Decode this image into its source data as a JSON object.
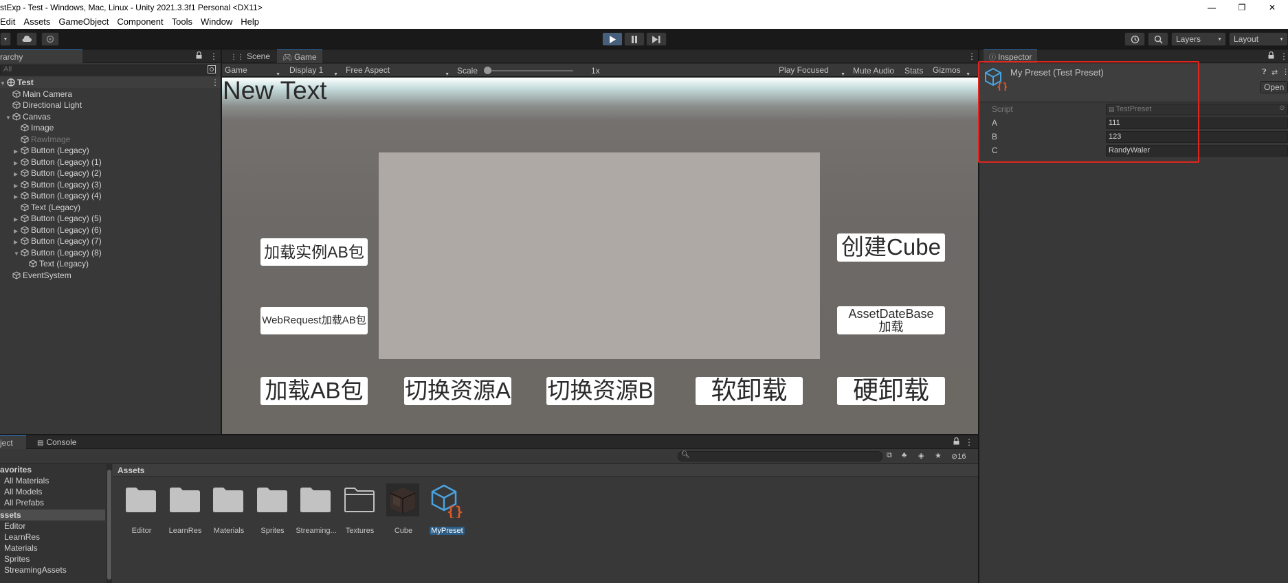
{
  "window": {
    "title": "stExp - Test - Windows, Mac, Linux - Unity 2021.3.3f1 Personal <DX11>",
    "minimize": "—",
    "maximize": "❐",
    "close": "✕"
  },
  "menu": [
    "Edit",
    "Assets",
    "GameObject",
    "Component",
    "Tools",
    "Window",
    "Help"
  ],
  "toolbar": {
    "play_icon": "play-icon",
    "pause_icon": "pause-icon",
    "step_icon": "step-icon",
    "layers_label": "Layers",
    "layout_label": "Layout"
  },
  "hierarchy": {
    "tab_label": "rarchy",
    "search_placeholder": "All",
    "items": [
      {
        "label": "Test",
        "level": 0,
        "expanded": true,
        "scene": true
      },
      {
        "label": "Main Camera",
        "level": 1
      },
      {
        "label": "Directional Light",
        "level": 1
      },
      {
        "label": "Canvas",
        "level": 1,
        "expanded": true
      },
      {
        "label": "Image",
        "level": 2
      },
      {
        "label": "RawImage",
        "level": 2,
        "dim": true
      },
      {
        "label": "Button (Legacy)",
        "level": 2,
        "collapsed": true
      },
      {
        "label": "Button (Legacy) (1)",
        "level": 2,
        "collapsed": true
      },
      {
        "label": "Button (Legacy) (2)",
        "level": 2,
        "collapsed": true
      },
      {
        "label": "Button (Legacy) (3)",
        "level": 2,
        "collapsed": true
      },
      {
        "label": "Button (Legacy) (4)",
        "level": 2,
        "collapsed": true
      },
      {
        "label": "Text (Legacy)",
        "level": 2
      },
      {
        "label": "Button (Legacy) (5)",
        "level": 2,
        "collapsed": true
      },
      {
        "label": "Button (Legacy) (6)",
        "level": 2,
        "collapsed": true
      },
      {
        "label": "Button (Legacy) (7)",
        "level": 2,
        "collapsed": true
      },
      {
        "label": "Button (Legacy) (8)",
        "level": 2,
        "expanded": true
      },
      {
        "label": "Text (Legacy)",
        "level": 3
      },
      {
        "label": "EventSystem",
        "level": 1
      }
    ]
  },
  "scene_tabs": {
    "scene": "Scene",
    "game": "Game"
  },
  "game_toolbar": {
    "view": "Game",
    "display": "Display 1",
    "aspect": "Free Aspect",
    "scale_label": "Scale",
    "scale_value": "1x",
    "play_focused": "Play Focused",
    "mute_audio": "Mute Audio",
    "stats": "Stats",
    "gizmos": "Gizmos"
  },
  "game_view": {
    "new_text": "New Text",
    "buttons": {
      "load_instance_ab": "加载实例AB包",
      "webrequest_ab": "WebRequest加载AB包",
      "create_cube": "创建Cube",
      "assetdatabase_load": [
        "AssetDateBase",
        "加载"
      ],
      "load_ab": "加载AB包",
      "switch_a": "切换资源A",
      "switch_b": "切换资源B",
      "soft_unload": "软卸载",
      "hard_unload": "硬卸载"
    }
  },
  "inspector": {
    "tab_label": "Inspector",
    "asset_title": "My Preset (Test Preset)",
    "open_button": "Open",
    "highlight_color": "#e0261f",
    "properties": [
      {
        "label": "Script",
        "value": "TestPreset",
        "readonly": true
      },
      {
        "label": "A",
        "value": "111"
      },
      {
        "label": "B",
        "value": "123"
      },
      {
        "label": "C",
        "value": "RandyWaler"
      }
    ]
  },
  "project": {
    "tab_label": "ject",
    "console_label": "Console",
    "favorites": {
      "header": "avorites",
      "items": [
        "All Materials",
        "All Models",
        "All Prefabs"
      ]
    },
    "assets_tree": {
      "header": "ssets",
      "items": [
        "Editor",
        "LearnRes",
        "Materials",
        "Sprites",
        "StreamingAssets"
      ]
    },
    "breadcrumb": "Assets",
    "hidden_count": "16",
    "assets": [
      {
        "name": "Editor",
        "kind": "folder"
      },
      {
        "name": "LearnRes",
        "kind": "folder"
      },
      {
        "name": "Materials",
        "kind": "folder"
      },
      {
        "name": "Sprites",
        "kind": "folder"
      },
      {
        "name": "Streaming...",
        "kind": "folder"
      },
      {
        "name": "Textures",
        "kind": "folder-empty"
      },
      {
        "name": "Cube",
        "kind": "prefab"
      },
      {
        "name": "MyPreset",
        "kind": "preset",
        "selected": true
      }
    ]
  }
}
